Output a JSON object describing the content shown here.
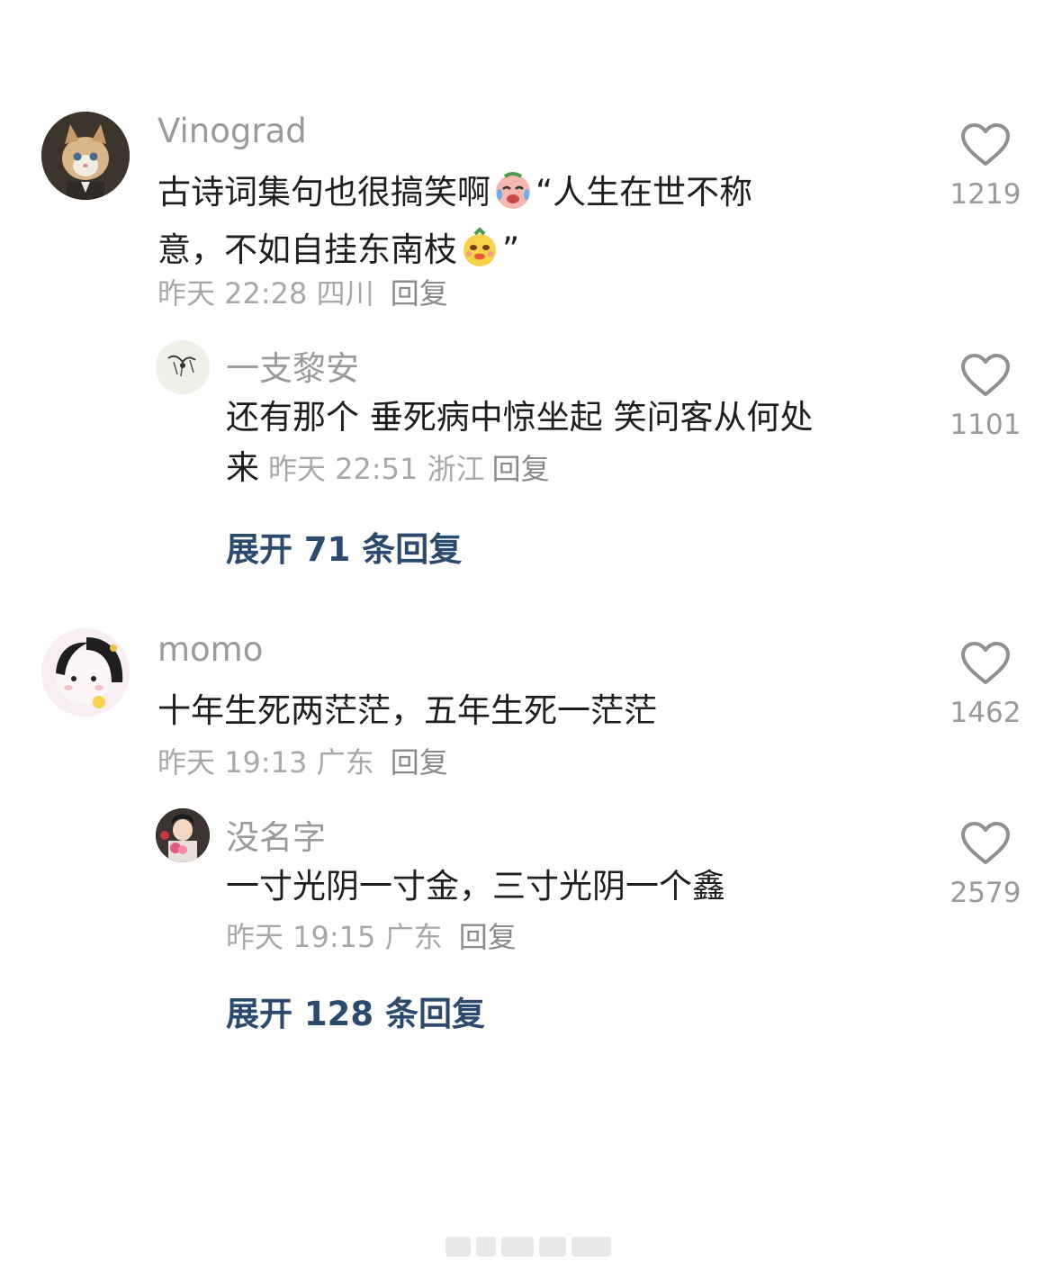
{
  "comments": [
    {
      "username": "Vinograd",
      "text_line1_a": "古诗词集句也很搞笑啊",
      "text_line1_b": "“人生在世不称",
      "text_line2_a": "意，不如自挂东南枝",
      "text_line2_b": "”",
      "time": "昨天 22:28",
      "location": "四川",
      "reply_label": "回复",
      "likes": "1219",
      "replies": [
        {
          "username": "一支黎安",
          "text_line1": "还有那个 垂死病中惊坐起  笑问客从何处",
          "text_line2": "来",
          "time": "昨天 22:51",
          "location": "浙江",
          "reply_label": "回复",
          "likes": "1101"
        }
      ],
      "expand_label": "展开 71 条回复"
    },
    {
      "username": "momo",
      "text": "十年生死两茫茫，五年生死一茫茫",
      "time": "昨天 19:13",
      "location": "广东",
      "reply_label": "回复",
      "likes": "1462",
      "replies": [
        {
          "username": "没名字",
          "text": "一寸光阴一寸金，三寸光阴一个鑫",
          "time": "昨天 19:15",
          "location": "广东",
          "reply_label": "回复",
          "likes": "2579"
        }
      ],
      "expand_label": "展开 128 条回复"
    }
  ],
  "colors": {
    "expand_link": "#2c4a6e",
    "username": "#9a9a9a",
    "meta": "#a8a8a8"
  }
}
